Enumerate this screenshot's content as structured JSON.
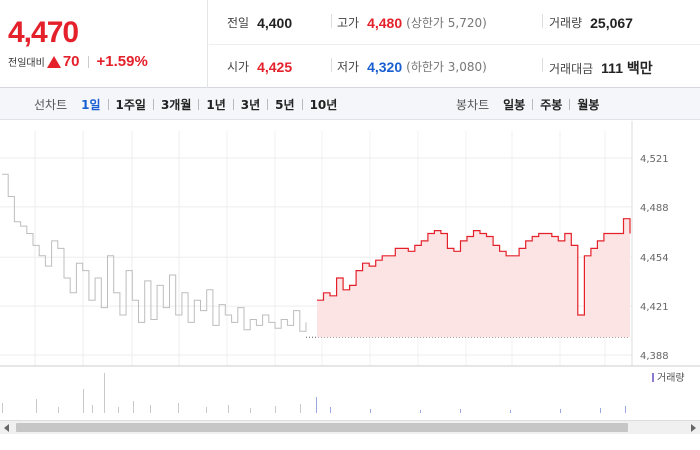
{
  "quote": {
    "price": "4,470",
    "change_label": "전일대비",
    "change_value": "70",
    "change_percent": "+1.59%",
    "direction": "up"
  },
  "stats": {
    "prev_close_label": "전일",
    "prev_close": "4,400",
    "high_label": "고가",
    "high": "4,480",
    "upper_limit": "(상한가 5,720)",
    "volume_label": "거래량",
    "volume": "25,067",
    "open_label": "시가",
    "open": "4,425",
    "low_label": "저가",
    "low": "4,320",
    "lower_limit": "(하한가 3,080)",
    "turnover_label": "거래대금",
    "turnover": "111 백만"
  },
  "toolbar": {
    "line_chart_label": "선차트",
    "periods": [
      "1일",
      "1주일",
      "3개월",
      "1년",
      "3년",
      "5년",
      "10년"
    ],
    "active_period": "1일",
    "candle_chart_label": "봉차트",
    "candles": [
      "일봉",
      "주봉",
      "월봉"
    ]
  },
  "chart_data": {
    "type": "line",
    "y_ticks": [
      "4,521",
      "4,488",
      "4,454",
      "4,421",
      "4,388"
    ],
    "ylim": [
      4388,
      4521
    ],
    "volume_legend": "거래량",
    "prev_close": 4400,
    "prev_day_series": [
      4510,
      4495,
      4478,
      4475,
      4470,
      4462,
      4455,
      4448,
      4465,
      4460,
      4440,
      4430,
      4450,
      4445,
      4425,
      4440,
      4420,
      4455,
      4430,
      4415,
      4445,
      4425,
      4410,
      4438,
      4412,
      4435,
      4420,
      4442,
      4415,
      4430,
      4410,
      4425,
      4418,
      4432,
      4408,
      4422,
      4415,
      4410,
      4420,
      4405,
      4412,
      4408,
      4415,
      4410,
      4406,
      4412,
      4408,
      4418,
      4404,
      4410
    ],
    "today_series": [
      4425,
      4430,
      4428,
      4440,
      4432,
      4435,
      4445,
      4450,
      4448,
      4452,
      4455,
      4455,
      4460,
      4460,
      4458,
      4462,
      4465,
      4470,
      4472,
      4470,
      4460,
      4458,
      4465,
      4468,
      4472,
      4470,
      4468,
      4462,
      4458,
      4455,
      4455,
      4460,
      4465,
      4468,
      4470,
      4470,
      4468,
      4465,
      4470,
      4462,
      4415,
      4455,
      4460,
      4465,
      4470,
      4470,
      4470,
      4480,
      4470
    ]
  }
}
